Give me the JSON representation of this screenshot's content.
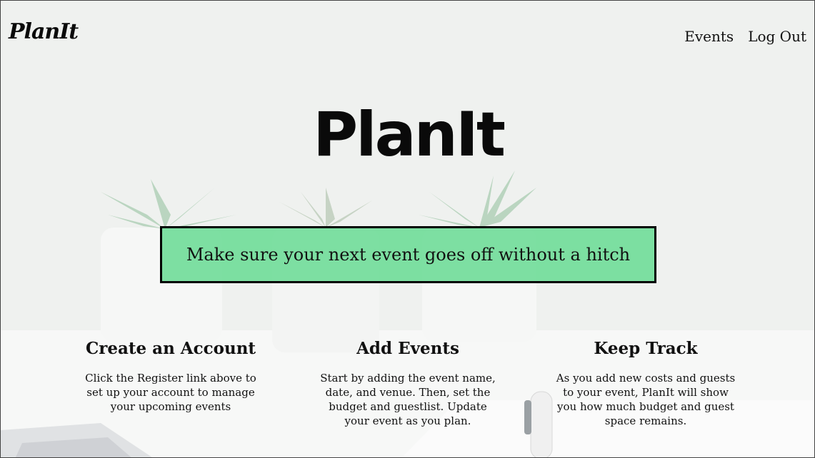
{
  "header": {
    "logo": "PlanIt",
    "nav": [
      {
        "label": "Events"
      },
      {
        "label": "Log Out"
      }
    ]
  },
  "hero": {
    "title": "PlanIt",
    "tagline": "Make sure your next event goes off without a hitch"
  },
  "features": [
    {
      "title": "Create an Account",
      "description": "Click the Register link above to set up your account to manage your upcoming events"
    },
    {
      "title": "Add Events",
      "description": "Start by adding the event name, date, and venue. Then, set the budget and guestlist. Update your event as you plan."
    },
    {
      "title": "Keep Track",
      "description": "As you add new costs and guests to your event, PlanIt will show you how much budget and guest space remains."
    }
  ],
  "colors": {
    "tagline_background": "#6cdc96",
    "text": "#111111"
  }
}
